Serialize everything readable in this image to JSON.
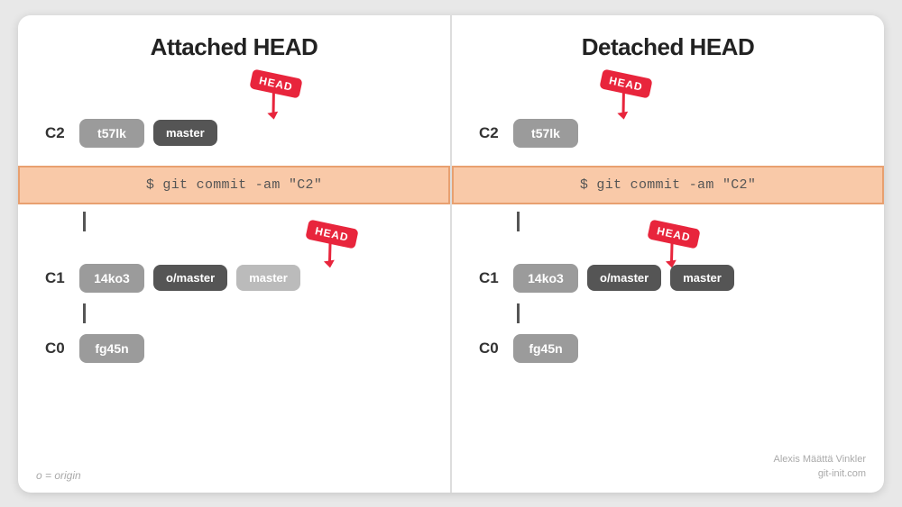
{
  "panels": [
    {
      "id": "attached",
      "title": "Attached HEAD",
      "commits": [
        {
          "label": "C2",
          "hash": "t57lk",
          "tags": [
            "master"
          ],
          "head_here": true,
          "head_on_tag": true
        },
        {
          "label": "C1",
          "hash": "14ko3",
          "tags": [
            "o/master",
            "master"
          ],
          "head_here": true,
          "head_on_tag": true,
          "tag_light": true
        },
        {
          "label": "C0",
          "hash": "fg45n",
          "tags": [],
          "head_here": false
        }
      ]
    },
    {
      "id": "detached",
      "title": "Detached HEAD",
      "commits": [
        {
          "label": "C2",
          "hash": "t57lk",
          "tags": [],
          "head_here": true,
          "head_on_commit": true
        },
        {
          "label": "C1",
          "hash": "14ko3",
          "tags": [
            "o/master",
            "master"
          ],
          "head_here": true,
          "head_on_tag": true
        },
        {
          "label": "C0",
          "hash": "fg45n",
          "tags": [],
          "head_here": false
        }
      ]
    }
  ],
  "commit_band": {
    "text": "$ git commit -am \"C2\""
  },
  "head_label": "HEAD",
  "attribution": {
    "name": "Alexis Määttä Vinkler",
    "site": "git-init.com"
  },
  "origin_note": "o = origin"
}
